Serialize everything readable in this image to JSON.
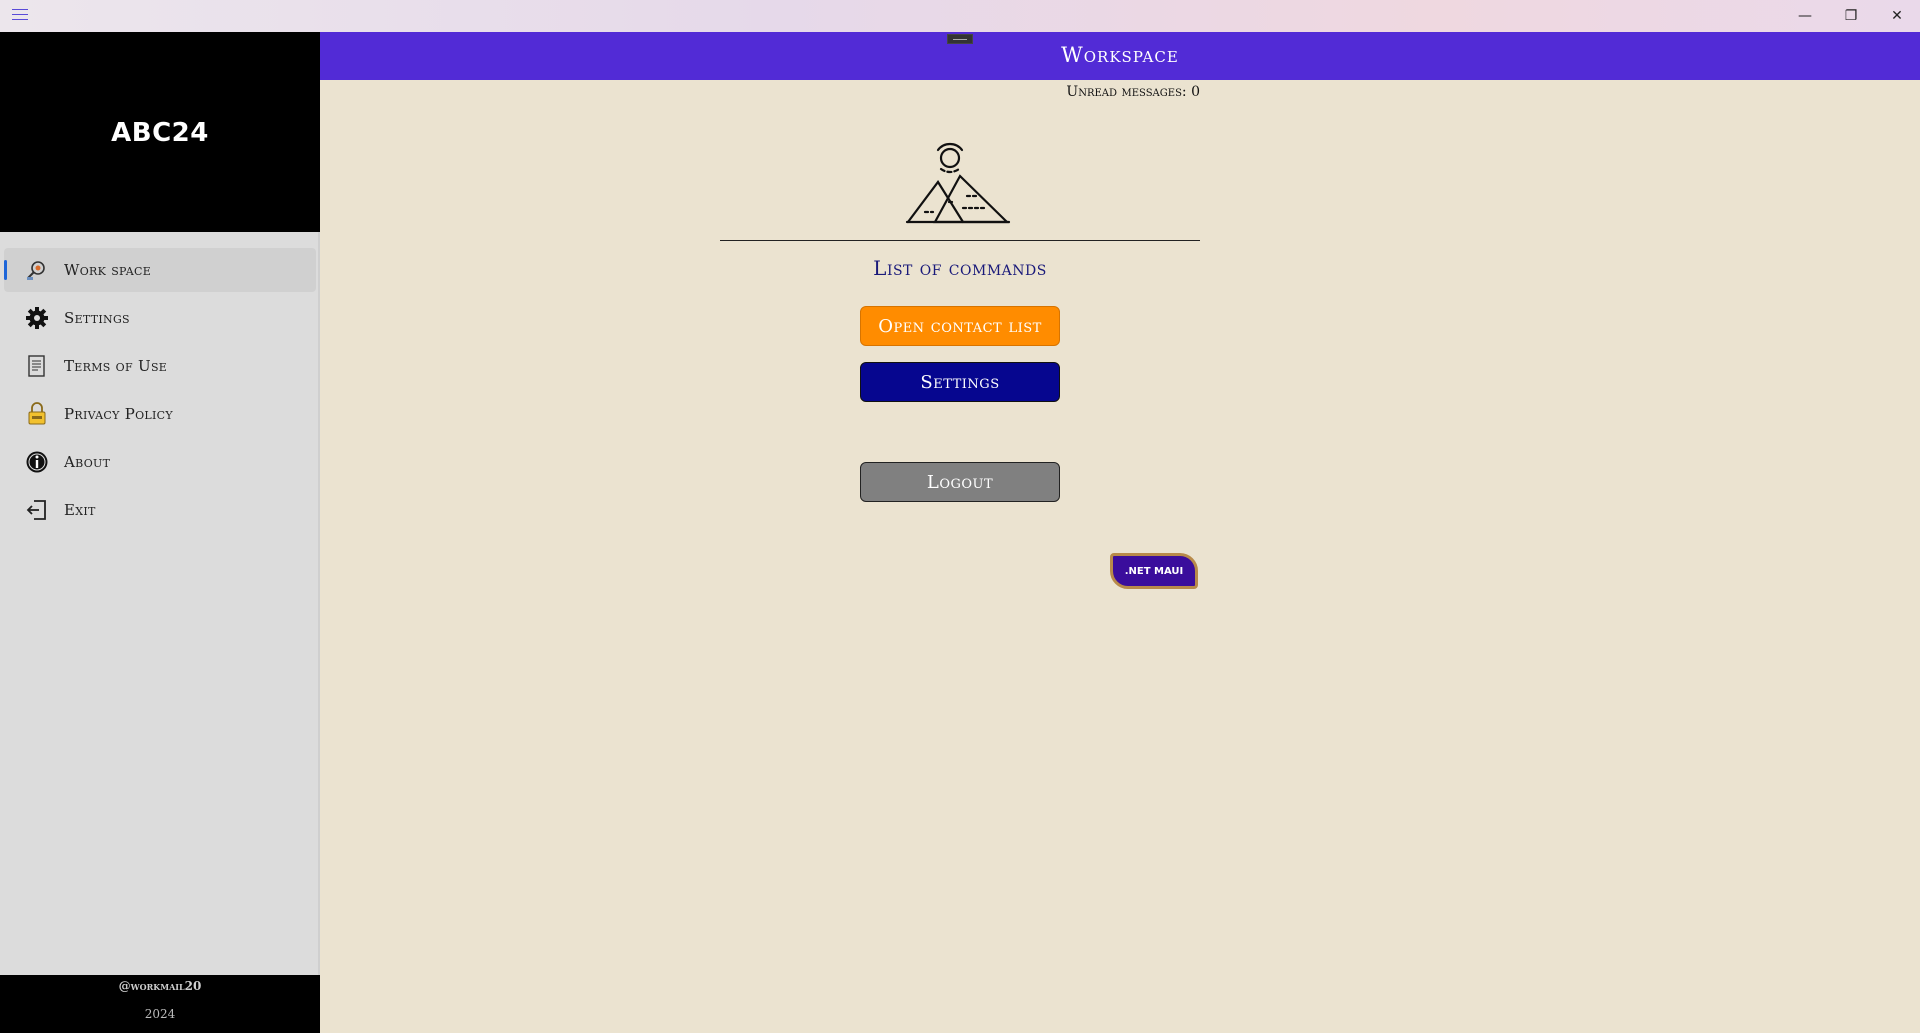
{
  "window": {
    "minimize_glyph": "—",
    "maximize_glyph": "❐",
    "close_glyph": "✕"
  },
  "sidebar": {
    "brand": "ABC24",
    "items": [
      {
        "label": "Work space",
        "icon": "workspace-search-icon",
        "active": true
      },
      {
        "label": "Settings",
        "icon": "gear-icon",
        "active": false
      },
      {
        "label": "Terms of Use",
        "icon": "document-icon",
        "active": false
      },
      {
        "label": "Privacy Policy",
        "icon": "lock-icon",
        "active": false
      },
      {
        "label": "About",
        "icon": "info-icon",
        "active": false
      },
      {
        "label": "Exit",
        "icon": "exit-icon",
        "active": false
      }
    ],
    "footer": {
      "handle": "@workmail20",
      "year": "2024"
    }
  },
  "header": {
    "title": "Workspace"
  },
  "main": {
    "unread": "Unread messages: 0",
    "logo_icon": "pyramids-sun-icon",
    "commands_title": "List of commands",
    "buttons": {
      "open_contacts": "Open contact list",
      "settings": "Settings",
      "logout": "Logout"
    },
    "badge": ".NET MAUI"
  },
  "colors": {
    "header": "#522bd6",
    "contacts_button": "#ff8c00",
    "settings_button": "#06068f",
    "logout_button": "#808080",
    "background": "#ebe3d0"
  }
}
